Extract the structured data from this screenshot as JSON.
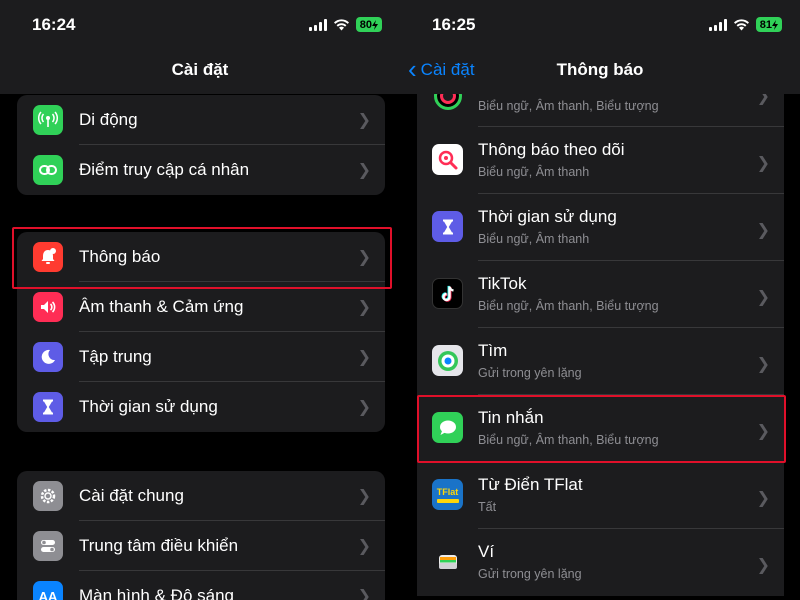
{
  "left": {
    "status": {
      "time": "16:24",
      "battery": "80"
    },
    "title": "Cài đặt",
    "groups": [
      [
        {
          "label": "Di động",
          "icon": "antenna-icon",
          "color": "#30d158"
        },
        {
          "label": "Điểm truy cập cá nhân",
          "icon": "hotspot-icon",
          "color": "#30d158"
        }
      ],
      [
        {
          "label": "Thông báo",
          "icon": "bell-icon",
          "color": "#ff3b30"
        },
        {
          "label": "Âm thanh & Cảm ứng",
          "icon": "speaker-icon",
          "color": "#ff2d55"
        },
        {
          "label": "Tập trung",
          "icon": "moon-icon",
          "color": "#5e5ce6"
        },
        {
          "label": "Thời gian sử dụng",
          "icon": "hourglass-icon",
          "color": "#5e5ce6"
        }
      ],
      [
        {
          "label": "Cài đặt chung",
          "icon": "gear-icon",
          "color": "#8e8e93"
        },
        {
          "label": "Trung tâm điều khiển",
          "icon": "toggles-icon",
          "color": "#8e8e93"
        },
        {
          "label": "Màn hình & Độ sáng",
          "icon": "text-size-icon",
          "color": "#0a84ff"
        }
      ]
    ]
  },
  "right": {
    "status": {
      "time": "16:25",
      "battery": "81"
    },
    "back_label": "Cài đặt",
    "title": "Thông báo",
    "partial_subtitle": "Biểu ngữ, Âm thanh, Biểu tượng",
    "apps": [
      {
        "name": "Thông báo theo dõi",
        "sub": "Biểu ngữ, Âm thanh",
        "icon": "tracking-icon"
      },
      {
        "name": "Thời gian sử dụng",
        "sub": "Biểu ngữ, Âm thanh",
        "icon": "hourglass-icon"
      },
      {
        "name": "TikTok",
        "sub": "Biểu ngữ, Âm thanh, Biểu tượng",
        "icon": "tiktok-icon"
      },
      {
        "name": "Tìm",
        "sub": "Gửi trong yên lặng",
        "icon": "find-my-icon"
      },
      {
        "name": "Tin nhắn",
        "sub": "Biểu ngữ, Âm thanh, Biểu tượng",
        "icon": "messages-icon"
      },
      {
        "name": "Từ Điển TFlat",
        "sub": "Tất",
        "icon": "tflat-icon"
      },
      {
        "name": "Ví",
        "sub": "Gửi trong yên lặng",
        "icon": "wallet-icon"
      }
    ],
    "tflat_logo_text": "TFlat"
  },
  "colors": {
    "highlight": "#e0102a",
    "accent": "#0a84ff",
    "row_bg": "#1c1c1e"
  }
}
